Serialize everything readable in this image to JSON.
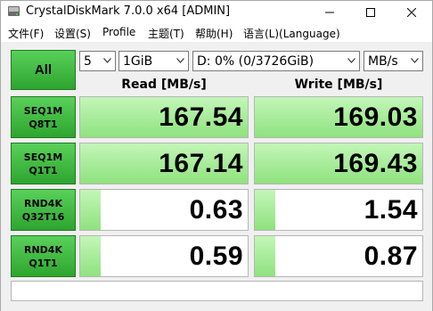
{
  "window": {
    "title": "CrystalDiskMark 7.0.0 x64 [ADMIN]"
  },
  "menu": [
    "文件(F)",
    "设置(S)",
    "Profile",
    "主题(T)",
    "帮助(H)",
    "语言(L)(Language)"
  ],
  "controls": {
    "all_label": "All",
    "count": "5",
    "size": "1GiB",
    "drive": "D: 0% (0/3726GiB)",
    "unit": "MB/s"
  },
  "headers": {
    "read": "Read [MB/s]",
    "write": "Write [MB/s]"
  },
  "tests": [
    {
      "line1": "SEQ1M",
      "line2": "Q8T1",
      "read": "167.54",
      "write": "169.03",
      "read_fill": 1.0,
      "write_fill": 1.0
    },
    {
      "line1": "SEQ1M",
      "line2": "Q1T1",
      "read": "167.14",
      "write": "169.43",
      "read_fill": 1.0,
      "write_fill": 1.0
    },
    {
      "line1": "RND4K",
      "line2": "Q32T16",
      "read": "0.63",
      "write": "1.54",
      "read_fill": 0.12,
      "write_fill": 0.12
    },
    {
      "line1": "RND4K",
      "line2": "Q1T1",
      "read": "0.59",
      "write": "0.87",
      "read_fill": 0.12,
      "write_fill": 0.12
    }
  ],
  "colors": {
    "accent_green": "#3fba40",
    "bar_green": "#a6ec98"
  }
}
